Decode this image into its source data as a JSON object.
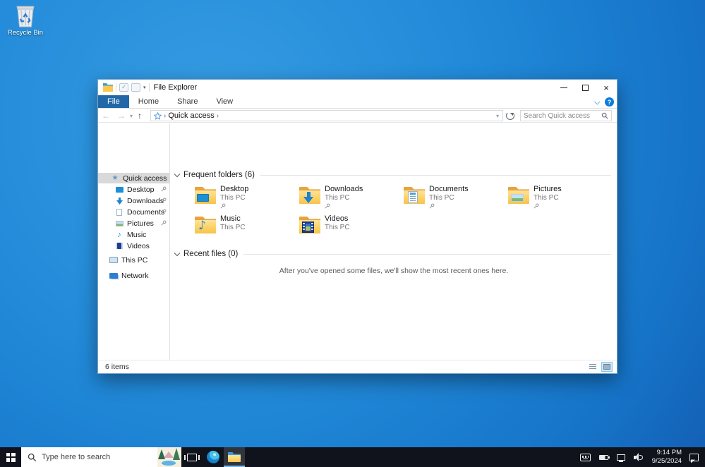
{
  "desktop": {
    "recycle_bin_label": "Recycle Bin"
  },
  "window": {
    "title": "File Explorer",
    "tabs": [
      {
        "label": "File"
      },
      {
        "label": "Home"
      },
      {
        "label": "Share"
      },
      {
        "label": "View"
      }
    ],
    "help_label": "?",
    "address": {
      "breadcrumb": "Quick access",
      "crumb_chevron": "›"
    },
    "search": {
      "placeholder": "Search Quick access"
    }
  },
  "sidebar": {
    "items": [
      {
        "label": "Quick access",
        "icon": "star-icon",
        "pinned": false,
        "selected": true
      },
      {
        "label": "Desktop",
        "icon": "monitor-icon",
        "pinned": true
      },
      {
        "label": "Downloads",
        "icon": "download-icon",
        "pinned": true
      },
      {
        "label": "Documents",
        "icon": "document-icon",
        "pinned": true
      },
      {
        "label": "Pictures",
        "icon": "picture-icon",
        "pinned": true
      },
      {
        "label": "Music",
        "icon": "music-icon",
        "pinned": false
      },
      {
        "label": "Videos",
        "icon": "video-icon",
        "pinned": false
      },
      {
        "label": "This PC",
        "icon": "computer-icon",
        "pinned": false
      },
      {
        "label": "Network",
        "icon": "network-icon",
        "pinned": false
      }
    ]
  },
  "content": {
    "sections": [
      {
        "title": "Frequent folders (6)"
      },
      {
        "title": "Recent files (0)"
      }
    ],
    "tiles": [
      {
        "name": "Desktop",
        "location": "This PC",
        "pinned": true
      },
      {
        "name": "Downloads",
        "location": "This PC",
        "pinned": true
      },
      {
        "name": "Documents",
        "location": "This PC",
        "pinned": true
      },
      {
        "name": "Pictures",
        "location": "This PC",
        "pinned": true
      },
      {
        "name": "Music",
        "location": "This PC",
        "pinned": false
      },
      {
        "name": "Videos",
        "location": "This PC",
        "pinned": false
      }
    ],
    "recent_empty_message": "After you've opened some files, we'll show the most recent ones here."
  },
  "statusbar": {
    "item_count": "6 items"
  },
  "taskbar": {
    "search_placeholder": "Type here to search",
    "clock": {
      "time": "9:14 PM",
      "date": "9/25/2024"
    }
  },
  "icons": {
    "note_glyph": "♪",
    "star_glyph": "★",
    "back_glyph": "←",
    "forward_glyph": "→",
    "up_glyph": "↑",
    "down_small_glyph": "▾",
    "close_glyph": "×",
    "check_glyph": "✓"
  },
  "colors": {
    "accent": "#0078d7",
    "file_tab": "#2268a8",
    "desktop_blue": "#2189d8",
    "taskbar_dark": "#10131c",
    "folder_yellow": "#fcd267",
    "selected_sidebar": "#d9d9d9"
  }
}
